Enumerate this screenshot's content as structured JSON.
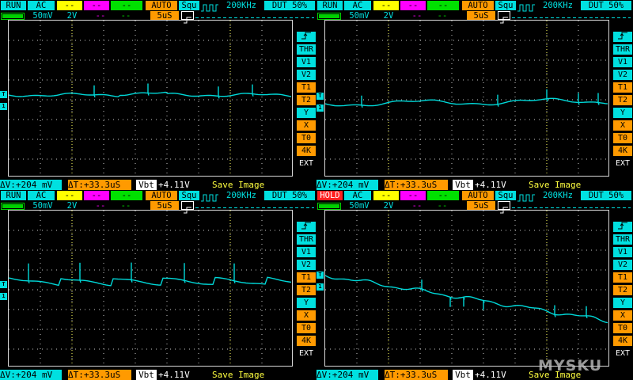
{
  "panels": [
    {
      "top": {
        "mode": "RUN",
        "coupling": "AC",
        "t1": "--",
        "t2": "--",
        "t3": "--",
        "trig": "AUTO",
        "wave": "Squ",
        "freq": "200KHz",
        "duty": "DUT 50%"
      },
      "row2": {
        "volt_div": "50mV",
        "probe": "2V",
        "m1": "--",
        "m2": "--",
        "time_div": "5uS"
      },
      "side_buttons": [
        "THR",
        "V1",
        "V2",
        "T1",
        "T2",
        "Y",
        "X",
        "T0",
        "4K",
        "EXT"
      ],
      "markers": {
        "trigger": "T",
        "channel": "1"
      },
      "bottom": {
        "dv": "ΔV:+204 mV",
        "dt": "ΔT:+33.3uS",
        "vbt_label": "Vbt",
        "vbt_value": "+4.11V",
        "save": "Save Image"
      }
    },
    {
      "top": {
        "mode": "RUN",
        "coupling": "AC",
        "t1": "--",
        "t2": "--",
        "t3": "--",
        "trig": "AUTO",
        "wave": "Squ",
        "freq": "200KHz",
        "duty": "DUT 50%"
      },
      "row2": {
        "volt_div": "50mV",
        "probe": "2V",
        "m1": "--",
        "m2": "--",
        "time_div": "5uS"
      },
      "side_buttons": [
        "THR",
        "V1",
        "V2",
        "T1",
        "T2",
        "Y",
        "X",
        "T0",
        "4K",
        "EXT"
      ],
      "markers": {
        "trigger": "T",
        "channel": "1"
      },
      "bottom": {
        "dv": "ΔV:+204 mV",
        "dt": "ΔT:+33.3uS",
        "vbt_label": "Vbt",
        "vbt_value": "+4.11V",
        "save": "Save Image"
      }
    },
    {
      "top": {
        "mode": "RUN",
        "coupling": "AC",
        "t1": "--",
        "t2": "--",
        "t3": "--",
        "trig": "AUTO",
        "wave": "Squ",
        "freq": "200KHz",
        "duty": "DUT 50%"
      },
      "row2": {
        "volt_div": "50mV",
        "probe": "2V",
        "m1": "--",
        "m2": "--",
        "time_div": "5uS"
      },
      "side_buttons": [
        "THR",
        "V1",
        "V2",
        "T1",
        "T2",
        "Y",
        "X",
        "T0",
        "4K",
        "EXT"
      ],
      "markers": {
        "trigger": "T",
        "channel": "1"
      },
      "bottom": {
        "dv": "ΔV:+204 mV",
        "dt": "ΔT:+33.3uS",
        "vbt_label": "Vbt",
        "vbt_value": "+4.11V",
        "save": "Save Image"
      }
    },
    {
      "top": {
        "mode": "HOLD",
        "coupling": "AC",
        "t1": "--",
        "t2": "--",
        "t3": "--",
        "trig": "AUTO",
        "wave": "Squ",
        "freq": "200KHz",
        "duty": "DUT 50%"
      },
      "row2": {
        "volt_div": "50mV",
        "probe": "2V",
        "m1": "--",
        "m2": "--",
        "time_div": "5uS"
      },
      "side_buttons": [
        "THR",
        "V1",
        "V2",
        "T1",
        "T2",
        "Y",
        "X",
        "T0",
        "4K",
        "EXT"
      ],
      "markers": {
        "trigger": "T",
        "channel": "1"
      },
      "bottom": {
        "dv": "ΔV:+204 mV",
        "dt": "ΔT:+33.3uS",
        "vbt_label": "Vbt",
        "vbt_value": "+4.11V",
        "save": "Save Image"
      }
    }
  ],
  "watermark": "MYSKU",
  "colors": {
    "cyan": "#00e0e0",
    "orange": "#ff9a00",
    "yellow": "#ffff00",
    "magenta": "#ff00ff",
    "green": "#00d000",
    "trace": "#00d8d8",
    "hold": "#ff2020"
  }
}
